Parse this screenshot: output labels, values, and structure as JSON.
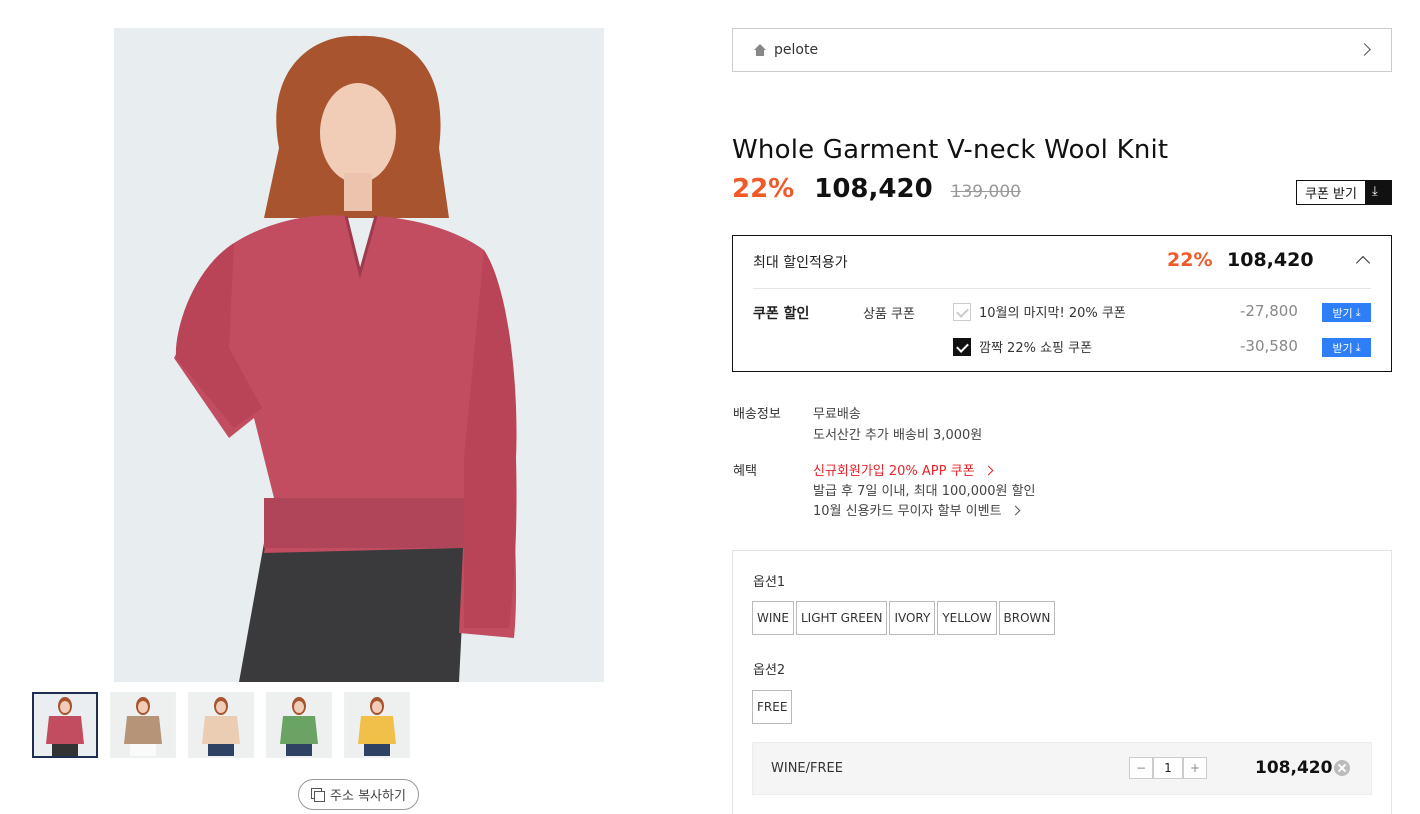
{
  "brand": {
    "name": "pelote"
  },
  "product": {
    "title": "Whole Garment V-neck Wool Knit",
    "discount_rate": "22%",
    "sale_price": "108,420",
    "original_price": "139,000",
    "coupon_download_label": "쿠폰 받기"
  },
  "max_discount": {
    "title": "최대 할인적용가",
    "rate": "22%",
    "price": "108,420",
    "coupon_section_label": "쿠폰 할인",
    "coupon_type_label": "상품 쿠폰",
    "coupons": [
      {
        "name": "10월의 마지막! 20% 쿠폰",
        "amount": "-27,800",
        "checked": false,
        "button": "받기"
      },
      {
        "name": "깜짝 22% 쇼핑 쿠폰",
        "amount": "-30,580",
        "checked": true,
        "button": "받기"
      }
    ]
  },
  "shipping": {
    "label": "배송정보",
    "line1": "무료배송",
    "line2": "도서산간 추가 배송비 3,000원"
  },
  "benefits": {
    "label": "혜택",
    "promo": "신규회원가입 20% APP 쿠폰",
    "promo_detail": "발급 후 7일 이내, 최대 100,000원 할인",
    "card_event": "10월 신용카드 무이자 할부 이벤트"
  },
  "options": {
    "option1_label": "옵션1",
    "option1_values": [
      "WINE",
      "LIGHT GREEN",
      "IVORY",
      "YELLOW",
      "BROWN"
    ],
    "option2_label": "옵션2",
    "option2_values": [
      "FREE"
    ],
    "selected": {
      "name": "WINE/FREE",
      "quantity": "1",
      "minus": "−",
      "plus": "+",
      "price": "108,420"
    }
  },
  "gallery": {
    "thumbnail_colors": [
      "#c24d60",
      "#b59478",
      "#eacdb3",
      "#6aa363",
      "#f0c048"
    ],
    "active_thumbnail": 0,
    "copy_url_label": "주소 복사하기"
  }
}
